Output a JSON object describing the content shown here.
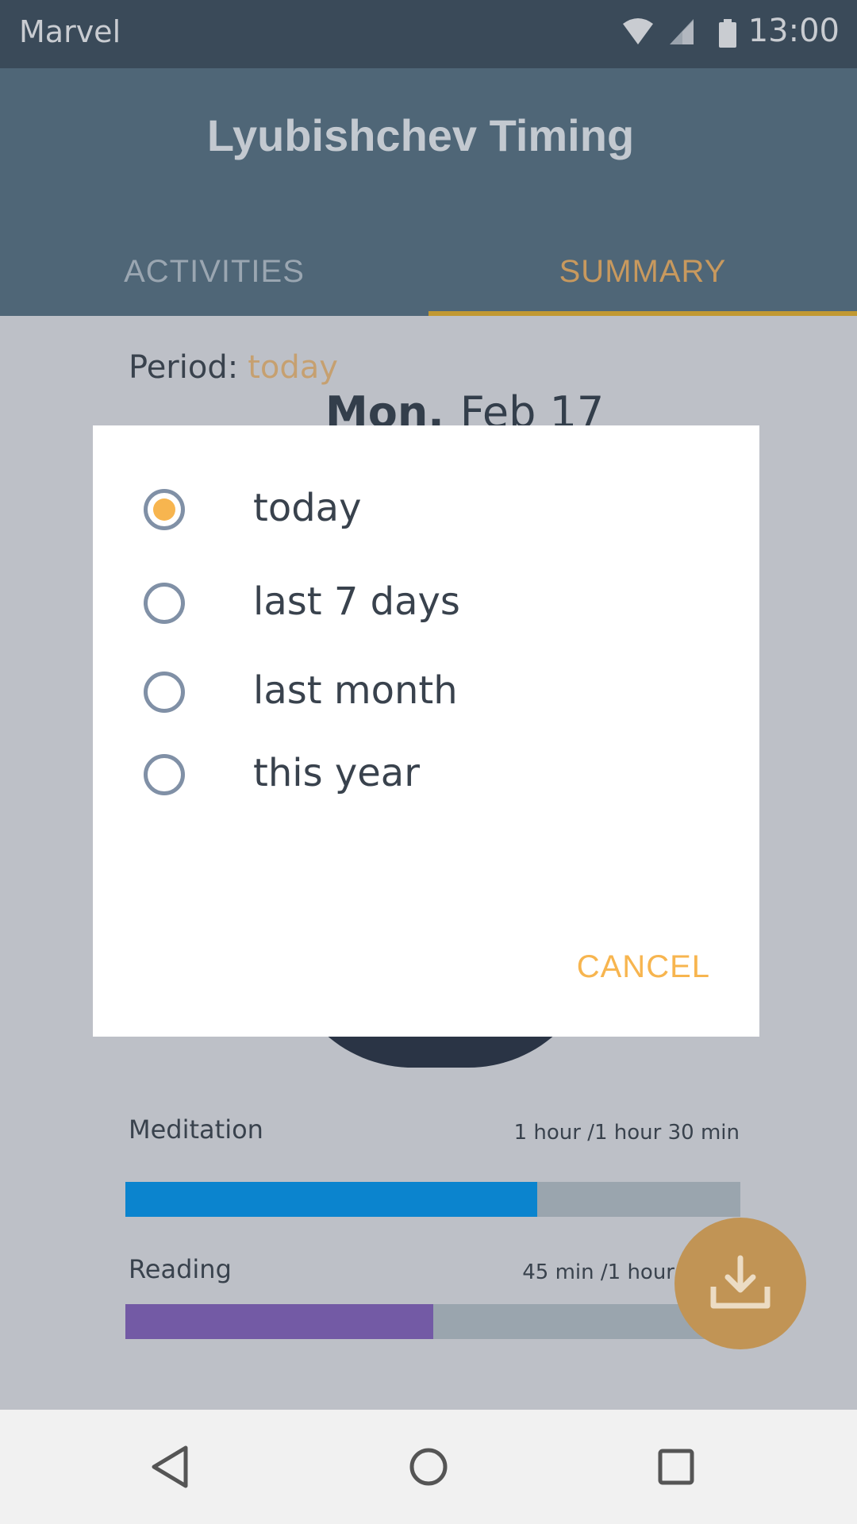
{
  "status_bar": {
    "carrier": "Marvel",
    "time": "13:00",
    "icons": [
      "wifi-icon",
      "cell-signal-icon",
      "battery-icon"
    ]
  },
  "app_bar": {
    "title": "Lyubishchev Timing",
    "tabs": [
      {
        "label": "ACTIVITIES",
        "selected": false
      },
      {
        "label": "SUMMARY",
        "selected": true
      }
    ]
  },
  "summary": {
    "period_label": "Period:",
    "period_value": "today",
    "day": "Mon.",
    "date": "Feb 17",
    "rows": [
      {
        "label": "Meditation",
        "value": "1 hour /1 hour 30 min",
        "fraction": 0.67,
        "color": "#0b84ce"
      },
      {
        "label": "Reading",
        "value": "45 min /1 hour",
        "fraction": 0.5,
        "color": "#735aa5"
      }
    ]
  },
  "period_dialog": {
    "options": [
      {
        "label": "today",
        "selected": true
      },
      {
        "label": "last 7 days",
        "selected": false
      },
      {
        "label": "last month",
        "selected": false
      },
      {
        "label": "this year",
        "selected": false
      }
    ],
    "cancel_label": "CANCEL"
  },
  "colors": {
    "accent": "#f7b54f",
    "appbar": "#4f6677",
    "statusbar": "#3a4a59",
    "tab_indicator": "#c19831",
    "fab": "#c19455"
  },
  "fab_icon": "download-icon",
  "nav_icons": [
    "back-icon",
    "home-icon",
    "recents-icon"
  ]
}
